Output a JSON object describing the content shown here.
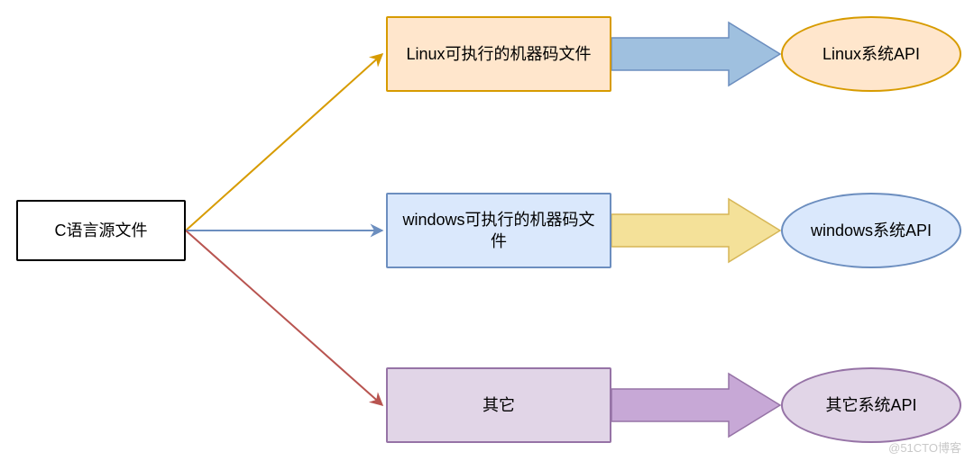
{
  "nodes": {
    "source": {
      "label": "C语言源文件"
    },
    "linux_box": {
      "label": "Linux可执行的机器码文件"
    },
    "windows_box": {
      "label": "windows可执行的机器码文件"
    },
    "other_box": {
      "label": "其它"
    },
    "linux_api": {
      "label": "Linux系统API"
    },
    "windows_api": {
      "label": "windows系统API"
    },
    "other_api": {
      "label": "其它系统API"
    }
  },
  "colors": {
    "source_border": "#000000",
    "source_fill": "#ffffff",
    "linux_border": "#d79b00",
    "linux_fill": "#ffe6cc",
    "windows_border": "#6c8ebf",
    "windows_fill": "#dae8fc",
    "other_border": "#9673a6",
    "other_fill": "#e1d5e7",
    "arrow_orange": "#d79b00",
    "arrow_blue": "#6c8ebf",
    "arrow_red": "#b85450",
    "block_arrow_blue": "#9fc0df",
    "block_arrow_yellow": "#f4e199",
    "block_arrow_purple": "#c7a8d6"
  },
  "watermark": "@51CTO博客"
}
